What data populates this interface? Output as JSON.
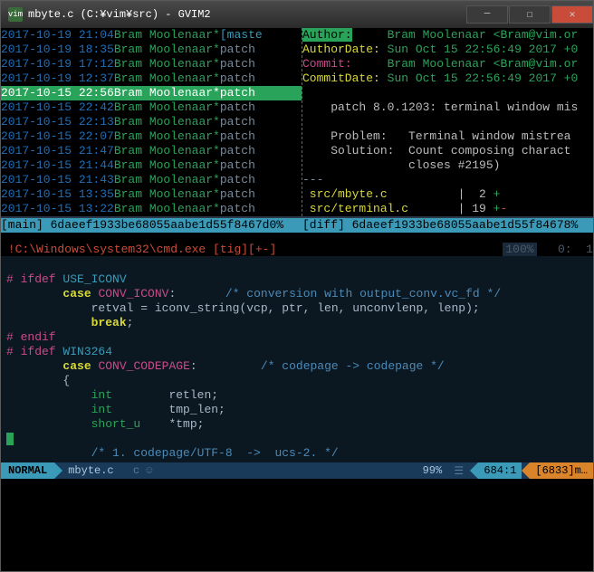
{
  "titlebar": {
    "icon_text": "vim",
    "text": "mbyte.c (C:¥vim¥src) - GVIM2"
  },
  "log": {
    "rows": [
      {
        "date": "2017-10-19 21:04",
        "author": "Bram Moolenaar",
        "tag": "[maste",
        "hl": false,
        "branch": true
      },
      {
        "date": "2017-10-19 18:35",
        "author": "Bram Moolenaar",
        "tag": "patch",
        "hl": false,
        "branch": false
      },
      {
        "date": "2017-10-19 17:12",
        "author": "Bram Moolenaar",
        "tag": "patch",
        "hl": false,
        "branch": false
      },
      {
        "date": "2017-10-19 12:37",
        "author": "Bram Moolenaar",
        "tag": "patch",
        "hl": false,
        "branch": false
      },
      {
        "date": "2017-10-15 22:56",
        "author": "Bram Moolenaar",
        "tag": "patch",
        "hl": true,
        "branch": false
      },
      {
        "date": "2017-10-15 22:42",
        "author": "Bram Moolenaar",
        "tag": "patch",
        "hl": false,
        "branch": false
      },
      {
        "date": "2017-10-15 22:13",
        "author": "Bram Moolenaar",
        "tag": "patch",
        "hl": false,
        "branch": false
      },
      {
        "date": "2017-10-15 22:07",
        "author": "Bram Moolenaar",
        "tag": "patch",
        "hl": false,
        "branch": false
      },
      {
        "date": "2017-10-15 21:47",
        "author": "Bram Moolenaar",
        "tag": "patch",
        "hl": false,
        "branch": false
      },
      {
        "date": "2017-10-15 21:44",
        "author": "Bram Moolenaar",
        "tag": "patch",
        "hl": false,
        "branch": false
      },
      {
        "date": "2017-10-15 21:43",
        "author": "Bram Moolenaar",
        "tag": "patch",
        "hl": false,
        "branch": false
      },
      {
        "date": "2017-10-15 13:35",
        "author": "Bram Moolenaar",
        "tag": "patch",
        "hl": false,
        "branch": false
      },
      {
        "date": "2017-10-15 13:22",
        "author": "Bram Moolenaar",
        "tag": "patch",
        "hl": false,
        "branch": false
      }
    ],
    "status": "[main] 6daeef1933be68055aabe1d55f8467d0%"
  },
  "diff": {
    "author_label": "Author:",
    "author_value": "Bram Moolenaar <Bram@vim.or",
    "authordate_label": "AuthorDate:",
    "authordate_value": "Sun Oct 15 22:56:49 2017 +0",
    "commit_label": "Commit:",
    "commit_value": "Bram Moolenaar <Bram@vim.or",
    "commitdate_label": "CommitDate:",
    "commitdate_value": "Sun Oct 15 22:56:49 2017 +0",
    "msg1": "    patch 8.0.1203: terminal window mis",
    "msg_problem_label": "    Problem:   ",
    "msg_problem_value": "Terminal window mistrea",
    "msg_solution_label": "    Solution:  ",
    "msg_solution_value": "Count composing charact",
    "msg_solution_value2": "               closes #2195)",
    "dashes": "---",
    "file1": " src/mbyte.c",
    "file1_sep": "|",
    "file1_num": "  2 ",
    "file1_plus": "+",
    "file2": " src/terminal.c",
    "file2_sep": "|",
    "file2_num": " 19 ",
    "file2_plus": "+",
    "file2_minus": "-",
    "status": "[diff] 6daeef1933be68055aabe1d55f84678%"
  },
  "cmdbar": {
    "text": " !C:\\Windows\\system32\\cmd.exe [tig][+-]",
    "pct": "100%",
    "right": "   0:  1"
  },
  "statusline": {
    "mode": "NORMAL",
    "file": "mbyte.c",
    "icons": " c ☺ ",
    "pct": "99%",
    "line": "684:",
    "col": "1",
    "warn": "[6833]m…"
  }
}
